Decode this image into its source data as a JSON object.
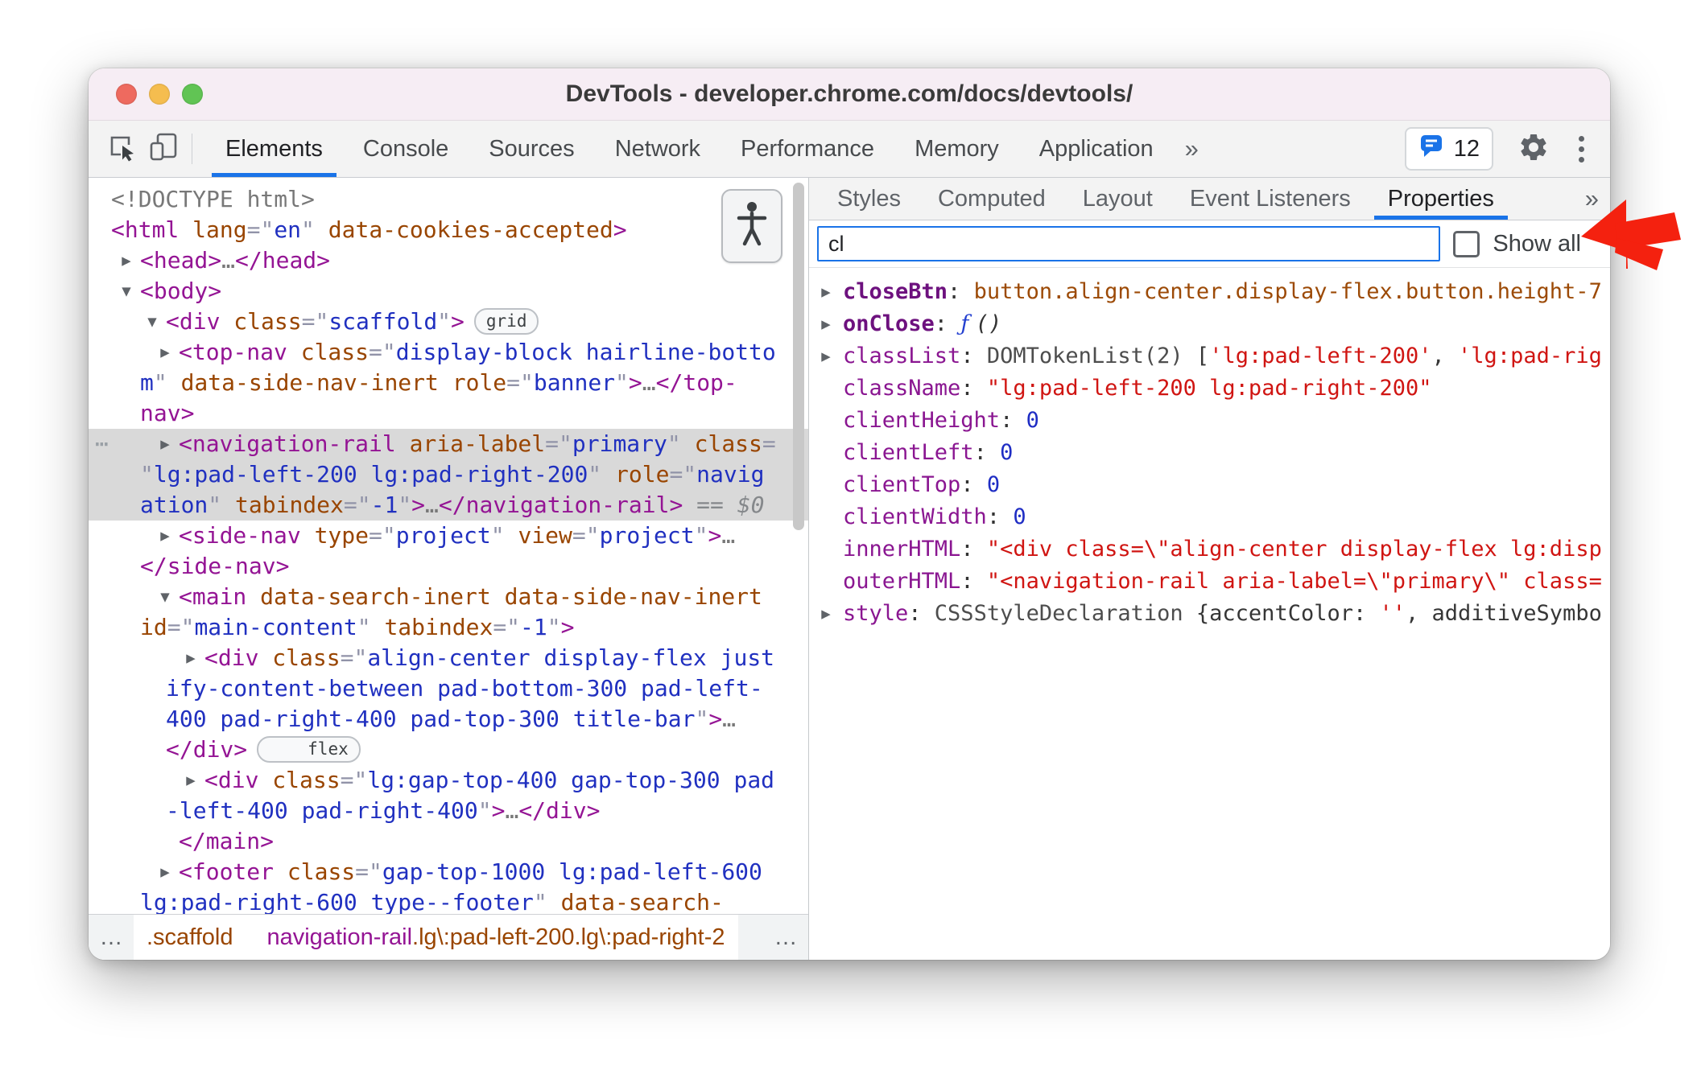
{
  "window": {
    "title": "DevTools - developer.chrome.com/docs/devtools/"
  },
  "colors": {
    "accent_blue": "#1a73e8",
    "selected_node_bg": "#d9d9d9",
    "annotation_arrow_red": "#f4210f",
    "traffic_red": "#ee6a5f",
    "traffic_yellow": "#f5bd4f",
    "traffic_green": "#61c454"
  },
  "icons": {
    "inspect": "cursor-in-square",
    "device_toolbar": "phone-tablet",
    "more_tabs": "»",
    "settings": "gear",
    "menu": "kebab-vertical",
    "console_messages": "speech-bubble",
    "accessibility": "person",
    "sidebar_more_tabs": "»"
  },
  "toolbar": {
    "tabs": [
      {
        "label": "Elements",
        "selected": true
      },
      {
        "label": "Console",
        "selected": false
      },
      {
        "label": "Sources",
        "selected": false
      },
      {
        "label": "Network",
        "selected": false
      },
      {
        "label": "Performance",
        "selected": false
      },
      {
        "label": "Memory",
        "selected": false
      },
      {
        "label": "Application",
        "selected": false
      }
    ],
    "more_tabs_glyph": "»",
    "console_badge_count": "12"
  },
  "elements_panel": {
    "tree": [
      {
        "pad": 28,
        "ti": 0,
        "segments": [
          [
            "g",
            "<!DOCTYPE html>"
          ]
        ]
      },
      {
        "pad": 28,
        "ti": 0,
        "segments": [
          [
            "p",
            "<html"
          ],
          [
            "o",
            " lang"
          ],
          [
            "q",
            "=\""
          ],
          [
            "b",
            "en"
          ],
          [
            "q",
            "\""
          ],
          [
            "o",
            " data-cookies-accepted"
          ],
          [
            "p",
            ">"
          ]
        ]
      },
      {
        "pad": 64,
        "ti": 0,
        "arrow": "r",
        "segments": [
          [
            "p",
            "<head>"
          ],
          [
            "g",
            "…"
          ],
          [
            "p",
            "</head>"
          ]
        ]
      },
      {
        "pad": 64,
        "ti": 0,
        "arrow": "d",
        "segments": [
          [
            "p",
            "<body>"
          ]
        ]
      },
      {
        "pad": 96,
        "ti": 0,
        "arrow": "d",
        "badge": "grid",
        "segments": [
          [
            "p",
            "<div"
          ],
          [
            "o",
            " class"
          ],
          [
            "q",
            "=\""
          ],
          [
            "b",
            "scaffold"
          ],
          [
            "q",
            "\""
          ],
          [
            "p",
            ">"
          ]
        ]
      },
      {
        "pad": 64,
        "ti": 48,
        "arrow": "r",
        "segments": [
          [
            "p",
            "<top-nav"
          ],
          [
            "o",
            " class"
          ],
          [
            "q",
            "=\""
          ],
          [
            "b",
            "display-block hairline-botto"
          ],
          [
            "br",
            ""
          ],
          [
            "b",
            "m"
          ],
          [
            "q",
            "\""
          ],
          [
            "o",
            " data-side-nav-inert"
          ],
          [
            "o",
            " role"
          ],
          [
            "q",
            "=\""
          ],
          [
            "b",
            "banner"
          ],
          [
            "q",
            "\""
          ],
          [
            "p",
            ">"
          ],
          [
            "g",
            "…"
          ],
          [
            "p",
            "</top-"
          ],
          [
            "br",
            ""
          ],
          [
            "p",
            "nav>"
          ]
        ]
      },
      {
        "pad": 64,
        "ti": 48,
        "arrow": "r",
        "selected": true,
        "gutter": true,
        "segments": [
          [
            "p",
            "<navigation-rail"
          ],
          [
            "o",
            " aria-label"
          ],
          [
            "q",
            "=\""
          ],
          [
            "b",
            "primary"
          ],
          [
            "q",
            "\""
          ],
          [
            "o",
            " class"
          ],
          [
            "q",
            "="
          ],
          [
            "br",
            ""
          ],
          [
            "q",
            "\""
          ],
          [
            "b",
            "lg:pad-left-200 lg:pad-right-200"
          ],
          [
            "q",
            "\""
          ],
          [
            "o",
            " role"
          ],
          [
            "q",
            "=\""
          ],
          [
            "b",
            "navig"
          ],
          [
            "br",
            ""
          ],
          [
            "b",
            "ation"
          ],
          [
            "q",
            "\""
          ],
          [
            "o",
            " tabindex"
          ],
          [
            "q",
            "=\""
          ],
          [
            "b",
            "-1"
          ],
          [
            "q",
            "\""
          ],
          [
            "p",
            ">"
          ],
          [
            "g",
            "…"
          ],
          [
            "p",
            "</navigation-rail>"
          ],
          [
            "s",
            " == "
          ],
          [
            "si",
            "$0"
          ]
        ]
      },
      {
        "pad": 64,
        "ti": 48,
        "arrow": "r",
        "segments": [
          [
            "p",
            "<side-nav"
          ],
          [
            "o",
            " type"
          ],
          [
            "q",
            "=\""
          ],
          [
            "b",
            "project"
          ],
          [
            "q",
            "\""
          ],
          [
            "o",
            " view"
          ],
          [
            "q",
            "=\""
          ],
          [
            "b",
            "project"
          ],
          [
            "q",
            "\""
          ],
          [
            "p",
            ">"
          ],
          [
            "g",
            "…"
          ],
          [
            "br",
            ""
          ],
          [
            "p",
            "</side-nav>"
          ]
        ]
      },
      {
        "pad": 64,
        "ti": 48,
        "arrow": "d",
        "segments": [
          [
            "p",
            "<main"
          ],
          [
            "o",
            " data-search-inert"
          ],
          [
            "o",
            " data-side-nav-inert"
          ],
          [
            "br",
            ""
          ],
          [
            "o",
            "id"
          ],
          [
            "q",
            "=\""
          ],
          [
            "b",
            "main-content"
          ],
          [
            "q",
            "\""
          ],
          [
            "o",
            " tabindex"
          ],
          [
            "q",
            "=\""
          ],
          [
            "b",
            "-1"
          ],
          [
            "q",
            "\""
          ],
          [
            "p",
            ">"
          ]
        ]
      },
      {
        "pad": 96,
        "ti": 48,
        "arrow": "r",
        "badge": "flex",
        "segments": [
          [
            "p",
            "<div"
          ],
          [
            "o",
            " class"
          ],
          [
            "q",
            "=\""
          ],
          [
            "b",
            "align-center display-flex just"
          ],
          [
            "br",
            ""
          ],
          [
            "b",
            "ify-content-between pad-bottom-300 pad-left-"
          ],
          [
            "br",
            ""
          ],
          [
            "b",
            "400 pad-right-400 pad-top-300 title-bar"
          ],
          [
            "q",
            "\""
          ],
          [
            "p",
            ">"
          ],
          [
            "g",
            "…"
          ],
          [
            "br",
            ""
          ],
          [
            "p",
            "</div>"
          ]
        ]
      },
      {
        "pad": 96,
        "ti": 48,
        "arrow": "r",
        "segments": [
          [
            "p",
            "<div"
          ],
          [
            "o",
            " class"
          ],
          [
            "q",
            "=\""
          ],
          [
            "b",
            "lg:gap-top-400 gap-top-300 pad"
          ],
          [
            "br",
            ""
          ],
          [
            "b",
            "-left-400 pad-right-400"
          ],
          [
            "q",
            "\""
          ],
          [
            "p",
            ">"
          ],
          [
            "g",
            "…"
          ],
          [
            "p",
            "</div>"
          ]
        ]
      },
      {
        "pad": 112,
        "ti": 0,
        "segments": [
          [
            "p",
            "</main>"
          ]
        ]
      },
      {
        "pad": 64,
        "ti": 48,
        "arrow": "r",
        "segments": [
          [
            "p",
            "<footer"
          ],
          [
            "o",
            " class"
          ],
          [
            "q",
            "=\""
          ],
          [
            "b",
            "gap-top-1000 lg:pad-left-600"
          ],
          [
            "br",
            ""
          ],
          [
            "b",
            "lg:pad-right-600 type--footer"
          ],
          [
            "q",
            "\""
          ],
          [
            "o",
            " data-search-"
          ]
        ]
      }
    ],
    "breadcrumb": {
      "left_ellipsis": "…",
      "crumb1_classes": ".scaffold",
      "crumb2_tag": "navigation-rail",
      "crumb2_classes": ".lg\\:pad-left-200.lg\\:pad-right-2",
      "right_ellipsis": "…"
    }
  },
  "sidebar": {
    "tabs": [
      {
        "label": "Styles",
        "selected": false
      },
      {
        "label": "Computed",
        "selected": false
      },
      {
        "label": "Layout",
        "selected": false
      },
      {
        "label": "Event Listeners",
        "selected": false
      },
      {
        "label": "Properties",
        "selected": true
      }
    ],
    "more_tabs_glyph": "»",
    "filter": {
      "value": "cl",
      "show_all_label": "Show all",
      "show_all_checked": false
    },
    "properties": [
      {
        "arrow": true,
        "bold": true,
        "name": "closeBtn",
        "segments": [
          [
            "dom",
            "button.align-center.display-flex.button.height-7"
          ]
        ]
      },
      {
        "arrow": true,
        "bold": true,
        "name": "onClose",
        "segments": [
          [
            "fi",
            "ƒ "
          ],
          [
            "it",
            "()"
          ]
        ]
      },
      {
        "arrow": true,
        "bold": false,
        "name": "classList",
        "segments": [
          [
            "gy",
            "DOMTokenList(2) "
          ],
          [
            "dk",
            "["
          ],
          [
            "st",
            "'lg:pad-left-200'"
          ],
          [
            "dk",
            ", "
          ],
          [
            "st",
            "'lg:pad-rig"
          ]
        ]
      },
      {
        "arrow": false,
        "bold": false,
        "name": "className",
        "segments": [
          [
            "st",
            "\"lg:pad-left-200 lg:pad-right-200\""
          ]
        ]
      },
      {
        "arrow": false,
        "bold": false,
        "name": "clientHeight",
        "segments": [
          [
            "num",
            "0"
          ]
        ]
      },
      {
        "arrow": false,
        "bold": false,
        "name": "clientLeft",
        "segments": [
          [
            "num",
            "0"
          ]
        ]
      },
      {
        "arrow": false,
        "bold": false,
        "name": "clientTop",
        "segments": [
          [
            "num",
            "0"
          ]
        ]
      },
      {
        "arrow": false,
        "bold": false,
        "name": "clientWidth",
        "segments": [
          [
            "num",
            "0"
          ]
        ]
      },
      {
        "arrow": false,
        "bold": false,
        "name": "innerHTML",
        "segments": [
          [
            "st",
            "\"<div class=\\\"align-center display-flex lg:disp"
          ]
        ]
      },
      {
        "arrow": false,
        "bold": false,
        "name": "outerHTML",
        "segments": [
          [
            "st",
            "\"<navigation-rail aria-label=\\\"primary\\\" class="
          ]
        ]
      },
      {
        "arrow": true,
        "bold": false,
        "name": "style",
        "segments": [
          [
            "gy",
            "CSSStyleDeclaration "
          ],
          [
            "dk",
            "{accentColor: "
          ],
          [
            "st",
            "''"
          ],
          [
            "dk",
            ", additiveSymbo"
          ]
        ]
      }
    ]
  }
}
